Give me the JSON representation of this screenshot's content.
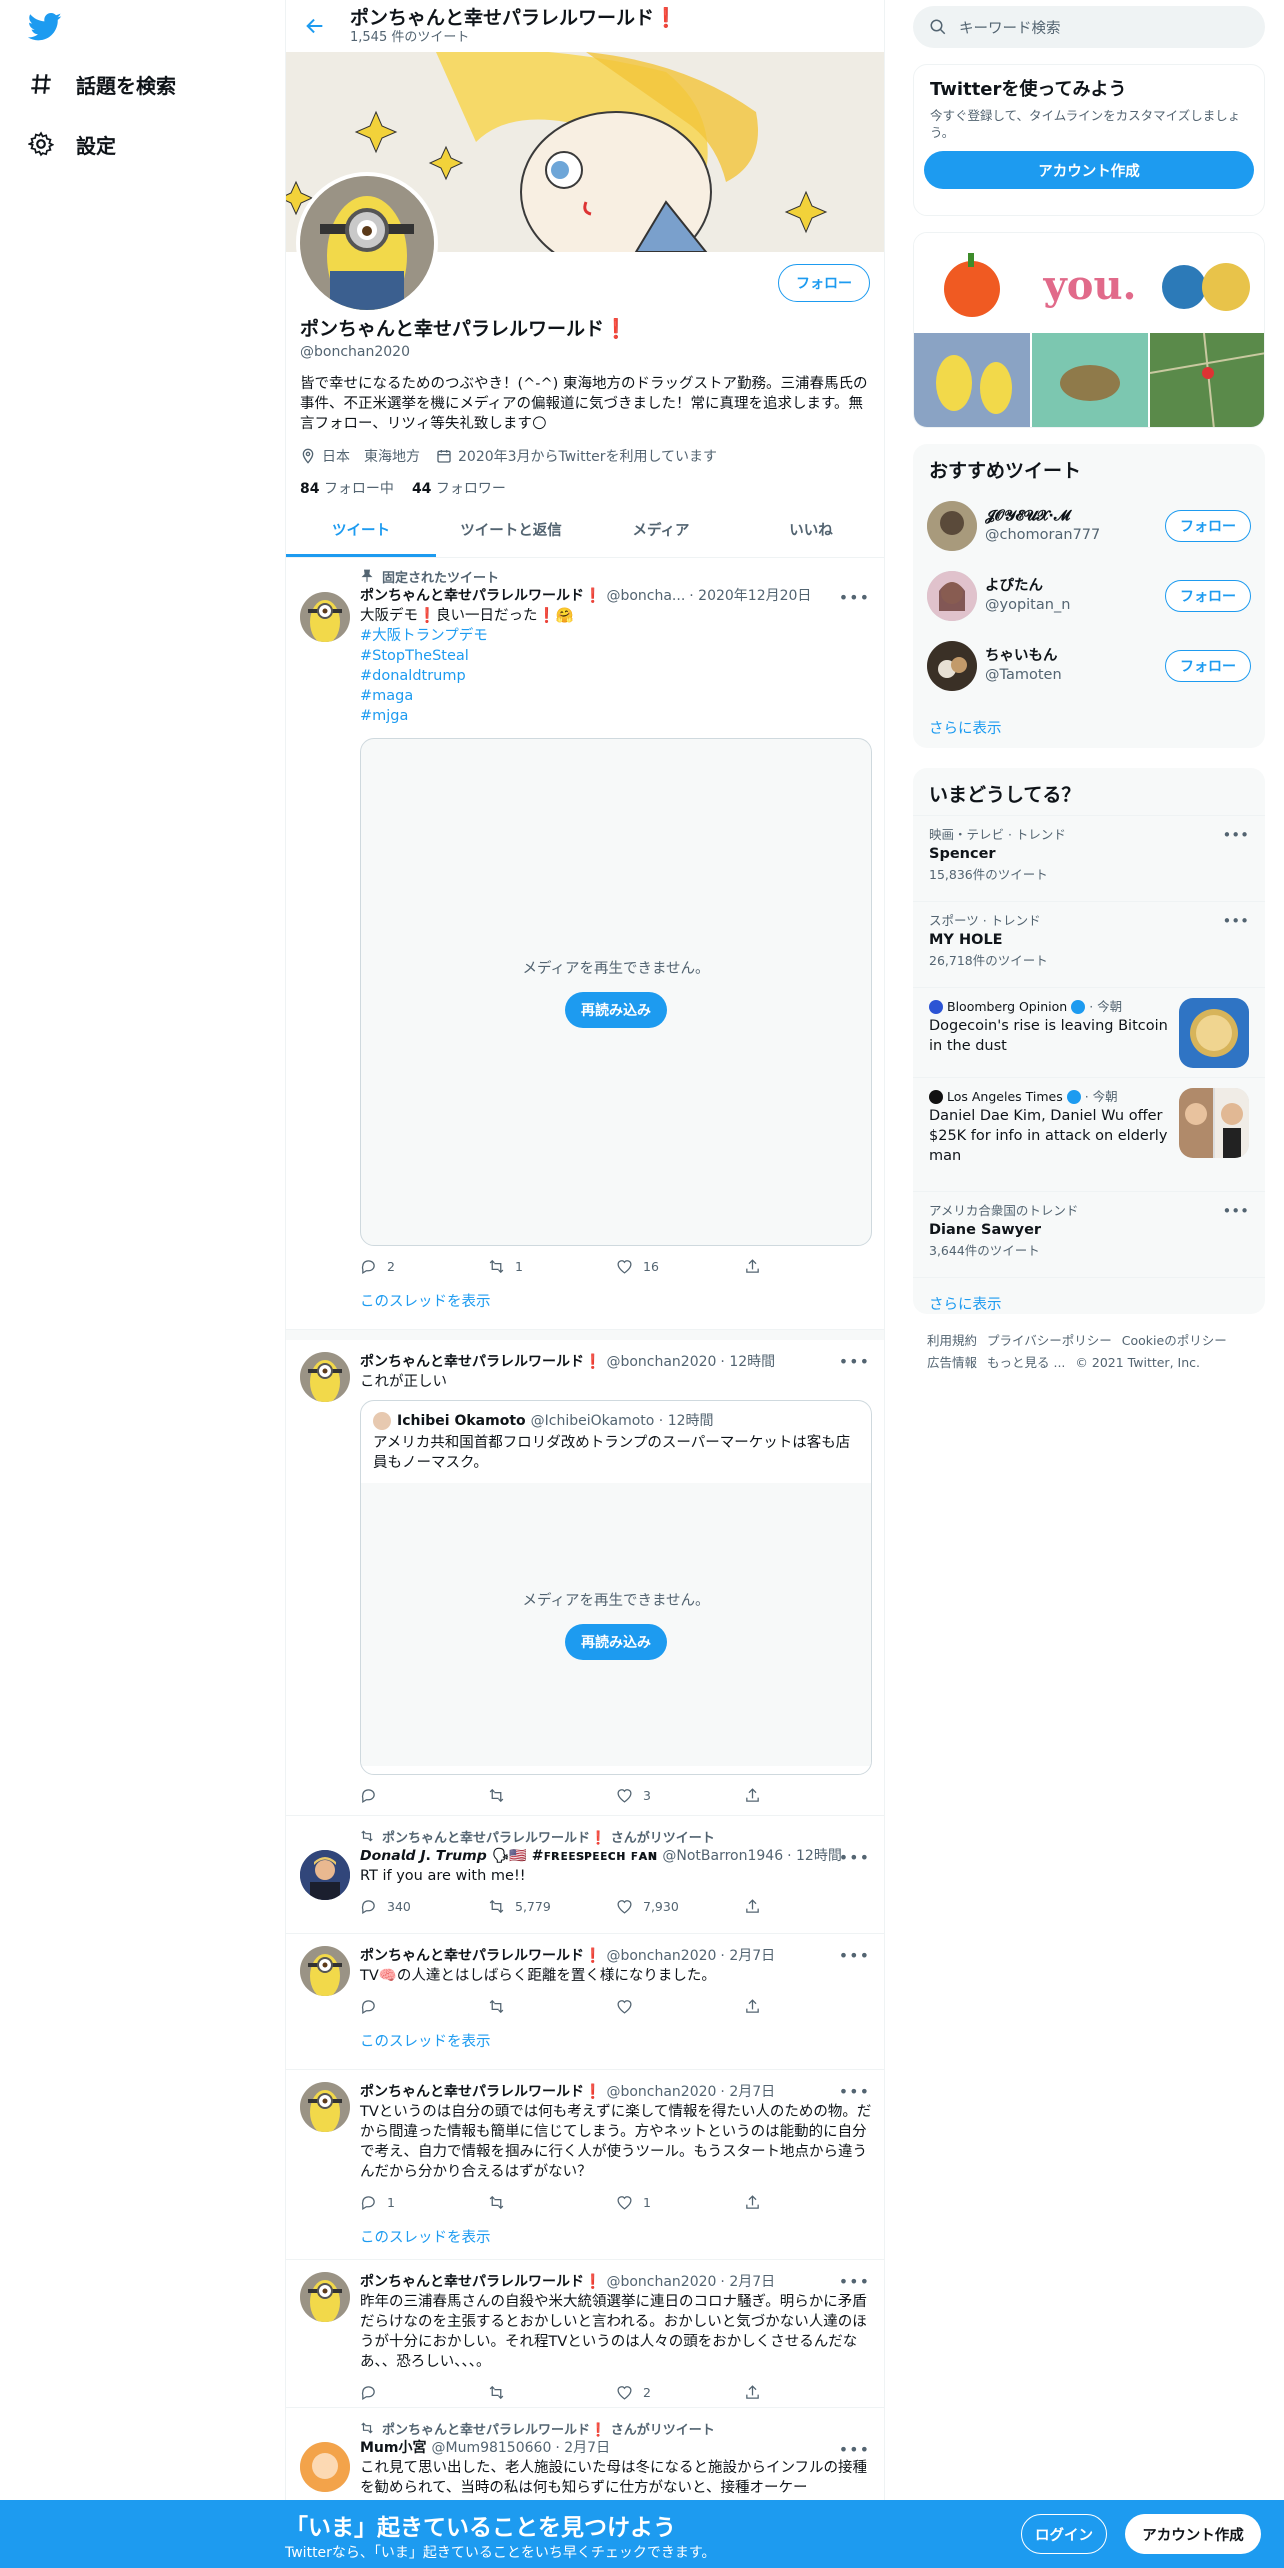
{
  "nav": {
    "explore_label": "話題を検索",
    "settings_label": "設定"
  },
  "header": {
    "name": "ポンちゃんと幸せパラレルワールド❗",
    "tweet_count": "1,545 件のツイート"
  },
  "profile": {
    "follow_label": "フォロー",
    "name": "ポンちゃんと幸せパラレルワールド❗",
    "handle": "@bonchan2020",
    "bio": "皆で幸せになるためのつぶやき！(^-^) 東海地方のドラッグストア勤務。三浦春馬氏の事件、不正米選挙を機にメディアの偏報道に気づきました！常に真理を追求します。無言フォロー、リツィ等失礼致します🌕",
    "location": "日本　東海地方",
    "joined": "2020年3月からTwitterを利用しています",
    "following_count": "84",
    "following_label": "フォロー中",
    "followers_count": "44",
    "followers_label": "フォロワー"
  },
  "tabs": [
    "ツイート",
    "ツイートと返信",
    "メディア",
    "いいね"
  ],
  "tweets": {
    "t1": {
      "context": "固定されたツイート",
      "name": "ポンちゃんと幸せパラレルワールド❗",
      "handle": "@boncha...",
      "time": "· 2020年12月20日",
      "text": "大阪デモ❗良い一日だった❗🤗",
      "tags": [
        "#大阪トランプデモ",
        "#StopTheSteal",
        "#donaldtrump",
        "#maga",
        "#mjga"
      ],
      "media_msg": "メディアを再生できません。",
      "reload": "再読み込み",
      "replies": "2",
      "retweets": "1",
      "likes": "16",
      "show_thread": "このスレッドを表示"
    },
    "t2": {
      "name": "ポンちゃんと幸せパラレルワールド❗",
      "handle": "@bonchan2020",
      "time": "· 12時間",
      "text": "これが正しい",
      "quote_name": "Ichibei Okamoto",
      "quote_handle": "@IchibeiOkamoto · 12時間",
      "quote_text": "アメリカ共和国首都フロリダ改めトランプのスーパーマーケットは客も店員もノーマスク。",
      "media_msg": "メディアを再生できません。",
      "reload": "再読み込み",
      "likes": "3"
    },
    "t3": {
      "context": "ポンちゃんと幸せパラレルワールド❗ さんがリツイート",
      "name": "𝘿𝙤𝙣𝙖𝙡𝙙 𝙅. 𝙏𝙧𝙪𝙢𝙥 🗣🇺🇸 #ꜰʀᴇᴇꜱᴘᴇᴇᴄʜ ꜰᴀɴ",
      "handle": "@NotBarron1946",
      "time": "· 12時間",
      "text": "RT if you are with me!!",
      "replies": "340",
      "retweets": "5,779",
      "likes": "7,930"
    },
    "t4": {
      "name": "ポンちゃんと幸せパラレルワールド❗",
      "handle": "@bonchan2020",
      "time": "· 2月7日",
      "text": "TV🧠の人達とはしばらく距離を置く様になりました。",
      "show_thread": "このスレッドを表示"
    },
    "t5": {
      "name": "ポンちゃんと幸せパラレルワールド❗",
      "handle": "@bonchan2020",
      "time": "· 2月7日",
      "text": "TVというのは自分の頭では何も考えずに楽して情報を得たい人のための物。だから間違った情報も簡単に信じてしまう。方やネットというのは能動的に自分で考え、自力で情報を掴みに行く人が使うツール。もうスタート地点から違うんだから分かり合えるはずがない？",
      "replies": "1",
      "likes": "1",
      "show_thread": "このスレッドを表示"
    },
    "t6": {
      "name": "ポンちゃんと幸せパラレルワールド❗",
      "handle": "@bonchan2020",
      "time": "· 2月7日",
      "text": "昨年の三浦春馬さんの自殺や米大統領選挙に連日のコロナ騒ぎ。明らかに矛盾だらけなのを主張するとおかしいと言われる。おかしいと気づかない人達のほうが十分におかしい。それ程TVというのは人々の頭をおかしくさせるんだなあ、、恐ろしい、、、。",
      "likes": "2"
    },
    "t7": {
      "context": "ポンちゃんと幸せパラレルワールド❗ さんがリツイート",
      "name": "Mum小宮",
      "handle": "@Mum98150660",
      "time": "· 2月7日",
      "text": "これ見て思い出した、老人施設にいた母は冬になると施設からインフルの接種を勧められて、当時の私は何も知らずに仕方がないと、接種オーケー"
    }
  },
  "search": {
    "placeholder": "キーワード検索"
  },
  "join": {
    "title": "Twitterを使ってみよう",
    "desc": "今すぐ登録して、タイムラインをカスタマイズしましょう。",
    "button": "アカウント作成"
  },
  "recommend": {
    "title": "おすすめツイート",
    "users": [
      {
        "name": "𝓙𝓞𝓨𝓔𝓤𝓧·𝓜",
        "handle": "@chomoran777",
        "button": "フォロー"
      },
      {
        "name": "よぴたん",
        "handle": "@yopitan_n",
        "button": "フォロー"
      },
      {
        "name": "ちゃいもん",
        "handle": "@Tamoten",
        "button": "フォロー"
      }
    ],
    "more": "さらに表示"
  },
  "trends": {
    "title": "いまどうしてる？",
    "items": [
      {
        "cat": "映画・テレビ · トレンド",
        "title": "Spencer",
        "count": "15,836件のツイート"
      },
      {
        "cat": "スポーツ · トレンド",
        "title": "MY HOLE",
        "count": "26,718件のツイート"
      },
      {
        "source": "Bloomberg Opinion",
        "time": "· 今朝",
        "title": "Dogecoin's rise is leaving Bitcoin in the dust"
      },
      {
        "source": "Los Angeles Times",
        "time": "· 今朝",
        "title": "Daniel Dae Kim, Daniel Wu offer $25K for info in attack on elderly man"
      },
      {
        "cat": "アメリカ合衆国のトレンド",
        "title": "Diane Sawyer",
        "count": "3,644件のツイート"
      }
    ],
    "more": "さらに表示"
  },
  "footer": {
    "terms": "利用規約",
    "privacy": "プライバシーポリシー",
    "cookie": "Cookieのポリシー",
    "ads": "広告情報",
    "more": "もっと見る ...",
    "copyright": "© 2021 Twitter, Inc."
  },
  "bottom": {
    "title": "「いま」起きていることを見つけよう",
    "sub": "Twitterなら、「いま」起きていることをいち早くチェックできます。",
    "login": "ログイン",
    "signup": "アカウント作成"
  },
  "colors": {
    "accent": "#1d9bf0",
    "text": "#0f1419",
    "muted": "#536471"
  }
}
